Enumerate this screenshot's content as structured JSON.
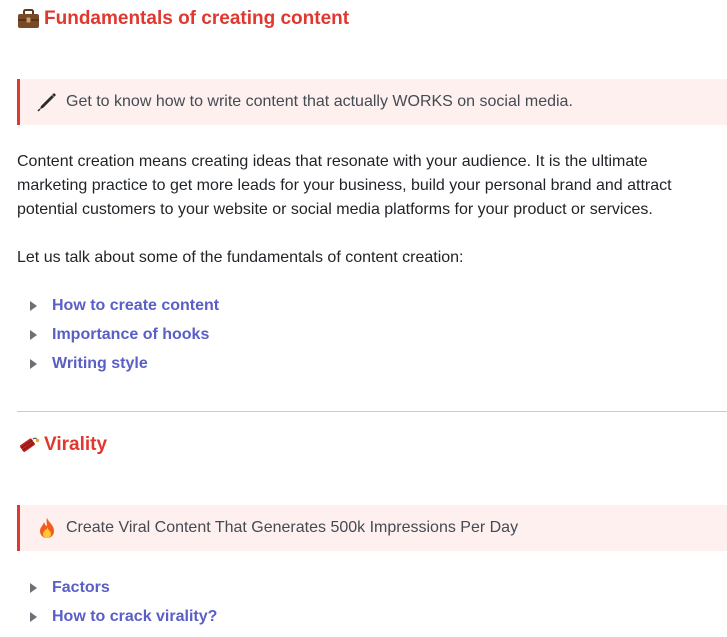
{
  "section1": {
    "icon": "briefcase-icon",
    "title": "Fundamentals of creating content",
    "callout_icon": "pen-icon",
    "callout": "Get to know how to write content that actually WORKS on social media.",
    "paragraph": "Content creation means creating ideas that resonate with your audience. It is the ultimate marketing practice to get more leads for your business, build your personal brand and attract potential customers to your website or social media platforms for your product or services.",
    "intro": "Let us talk about some of the fundamentals of content creation:",
    "items": [
      {
        "label": "How to create content"
      },
      {
        "label": "Importance of hooks"
      },
      {
        "label": "Writing style"
      }
    ]
  },
  "section2": {
    "icon": "firecracker-icon",
    "title": "Virality",
    "callout_icon": "fire-icon",
    "callout": "Create Viral Content That Generates 500k Impressions Per Day",
    "items": [
      {
        "label": "Factors"
      },
      {
        "label": "How to crack virality?"
      }
    ]
  },
  "colors": {
    "heading": "#e0382f",
    "link": "#5a5fc6",
    "callout_bg": "#fdf0ef"
  }
}
